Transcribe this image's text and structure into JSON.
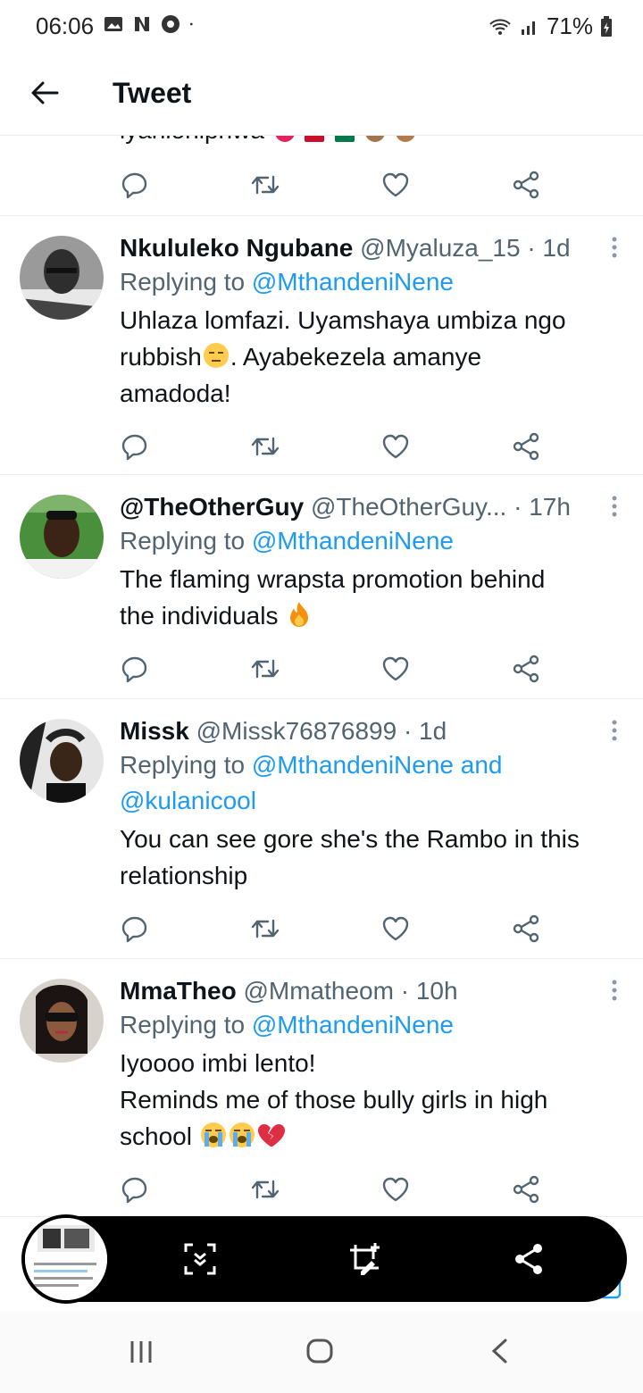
{
  "status_bar": {
    "time": "06:06",
    "battery": "71%"
  },
  "header": {
    "title": "Tweet"
  },
  "partial_tweet": {
    "text": "iyanionipnwa"
  },
  "tweets": [
    {
      "name": "Nkululeko Ngubane",
      "handle": "@Myaluza_15",
      "time": "· 1d",
      "reply_prefix": "Replying to",
      "reply_to": "@MthandeniNene",
      "text_1": "Uhlaza lomfazi. Uyamshaya umbiza ngo",
      "text_2a": "rubbish",
      "text_2b": ". Ayabekezela amanye",
      "text_3": "amadoda!"
    },
    {
      "name": "@TheOtherGuy",
      "handle": "@TheOtherGuy...",
      "time": "· 17h",
      "reply_prefix": "Replying to",
      "reply_to": "@MthandeniNene",
      "text_1": "The flaming wrapsta promotion behind",
      "text_2": "the individuals"
    },
    {
      "name": "Missk",
      "handle": "@Missk76876899",
      "time": "· 1d",
      "reply_prefix": "Replying to",
      "reply_to": "@MthandeniNene and",
      "reply_to_2": "@kulanicool",
      "text_1": "You can see gore she's the Rambo in this",
      "text_2": "relationship"
    },
    {
      "name": "MmaTheo",
      "handle": "@Mmatheom",
      "time": "· 10h",
      "reply_prefix": "Replying to",
      "reply_to": "@MthandeniNene",
      "text_1": "Iyoooo imbi lento!",
      "text_2": "Reminds me of those bully girls in high",
      "text_3": "school"
    }
  ],
  "colors": {
    "link": "#1d9bf0",
    "muted": "#536471",
    "text": "#0f1419",
    "divider": "#e6ecf0"
  },
  "icons": [
    "back-arrow-icon",
    "reply-icon",
    "retweet-icon",
    "like-icon",
    "share-icon",
    "more-icon",
    "scroll-capture-icon",
    "crop-edit-icon",
    "share-capture-icon",
    "recent-apps-icon",
    "home-icon",
    "back-nav-icon"
  ]
}
